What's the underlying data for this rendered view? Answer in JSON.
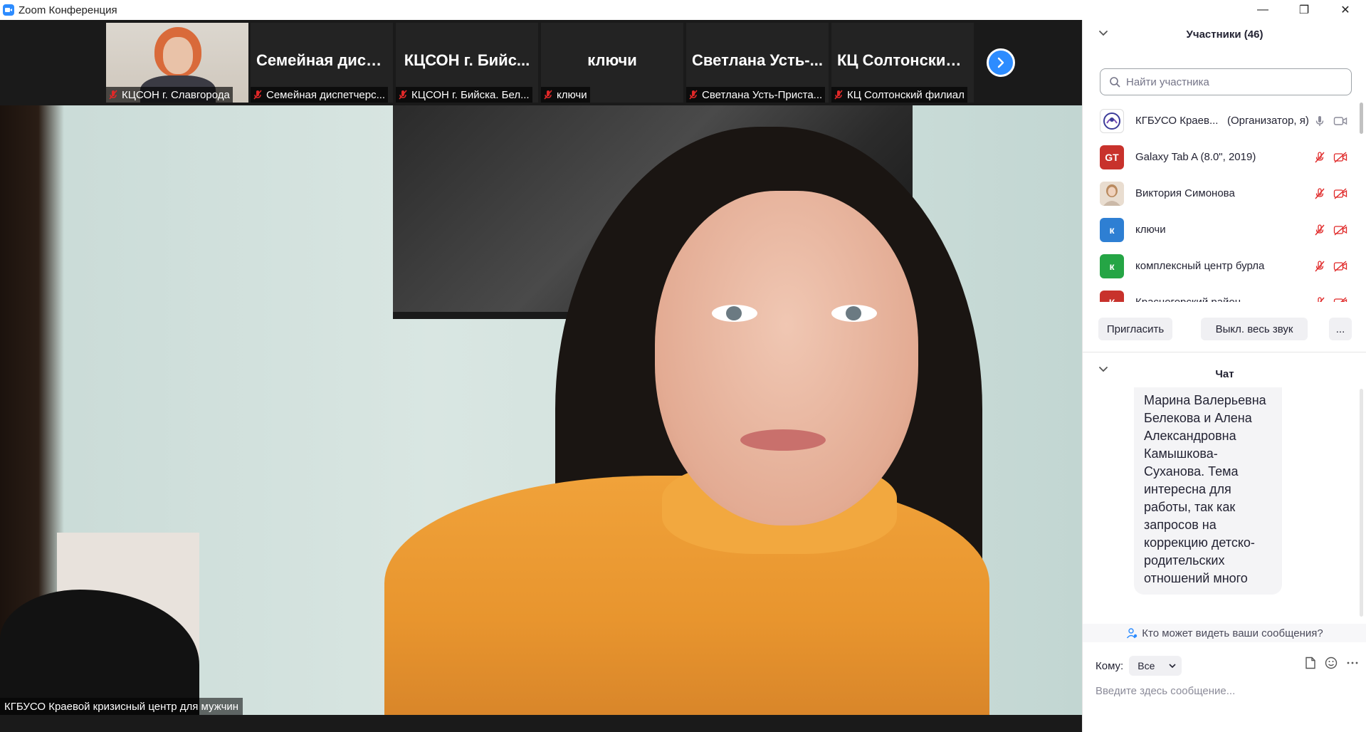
{
  "window": {
    "title": "Zoom Конференция",
    "minimize_label": "—",
    "restore_label": "❐",
    "close_label": "✕"
  },
  "thumbnails": [
    {
      "big": "",
      "label": "КЦСОН г. Славгорода",
      "has_photo": true
    },
    {
      "big": "Семейная дисп...",
      "label": "Семейная диспетчерс..."
    },
    {
      "big": "КЦСОН г. Бийс...",
      "label": "КЦСОН г. Бийска. Бел..."
    },
    {
      "big": "ключи",
      "label": "ключи"
    },
    {
      "big": "Светлана Усть-...",
      "label": "Светлана Усть-Приста..."
    },
    {
      "big": "КЦ Солтонский...",
      "label": "КЦ Солтонский филиал"
    }
  ],
  "speaker": {
    "label": "КГБУСО Краевой кризисный центр для мужчин"
  },
  "participants": {
    "header": "Участники (46)",
    "search_placeholder": "Найти участника",
    "items": [
      {
        "name": "КГБУСО Краев...",
        "role": "(Организатор, я)",
        "initials": "",
        "color": "#ffffff",
        "muted": false
      },
      {
        "name": "Galaxy Tab A (8.0\", 2019)",
        "role": "",
        "initials": "GT",
        "color": "#c8322c",
        "muted": true
      },
      {
        "name": "Виктория Симонова",
        "role": "",
        "initials": "",
        "color": "#d8c7b5",
        "muted": true
      },
      {
        "name": "ключи",
        "role": "",
        "initials": "к",
        "color": "#2e7fd3",
        "muted": true
      },
      {
        "name": "комплексный центр бурла",
        "role": "",
        "initials": "к",
        "color": "#25a545",
        "muted": true
      },
      {
        "name": "Красногорский район",
        "role": "",
        "initials": "К",
        "color": "#c8322c",
        "muted": true
      }
    ],
    "invite_label": "Пригласить",
    "mute_all_label": "Выкл. весь звук",
    "more_label": "..."
  },
  "chat": {
    "header": "Чат",
    "message": "Марина Валерьевна\nБелекова и Алена\nАлександровна\nКамышкова-\nСуханова. Тема\nинтересна для\nработы, так как\nзапросов на\nкоррекцию  детско-\nродительских\nотношений много",
    "who_sees": "Кто может видеть ваши сообщения?",
    "to_label": "Кому:",
    "to_value": "Все",
    "input_placeholder": "Введите здесь сообщение..."
  },
  "colors": {
    "accent": "#2d8cff",
    "muted_red": "#e02828"
  }
}
